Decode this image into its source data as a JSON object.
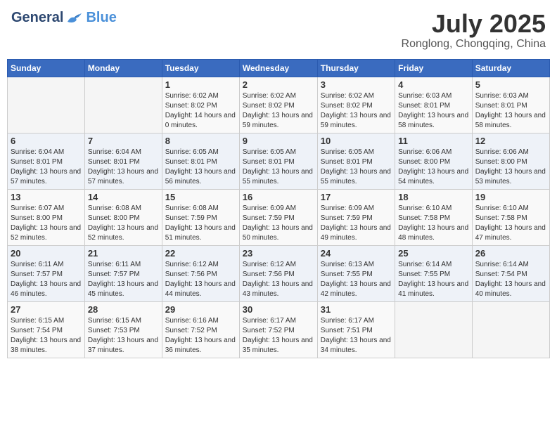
{
  "header": {
    "logo_general": "General",
    "logo_blue": "Blue",
    "month": "July 2025",
    "location": "Ronglong, Chongqing, China"
  },
  "weekdays": [
    "Sunday",
    "Monday",
    "Tuesday",
    "Wednesday",
    "Thursday",
    "Friday",
    "Saturday"
  ],
  "weeks": [
    [
      {
        "day": "",
        "sunrise": "",
        "sunset": "",
        "daylight": ""
      },
      {
        "day": "",
        "sunrise": "",
        "sunset": "",
        "daylight": ""
      },
      {
        "day": "1",
        "sunrise": "Sunrise: 6:02 AM",
        "sunset": "Sunset: 8:02 PM",
        "daylight": "Daylight: 14 hours and 0 minutes."
      },
      {
        "day": "2",
        "sunrise": "Sunrise: 6:02 AM",
        "sunset": "Sunset: 8:02 PM",
        "daylight": "Daylight: 13 hours and 59 minutes."
      },
      {
        "day": "3",
        "sunrise": "Sunrise: 6:02 AM",
        "sunset": "Sunset: 8:02 PM",
        "daylight": "Daylight: 13 hours and 59 minutes."
      },
      {
        "day": "4",
        "sunrise": "Sunrise: 6:03 AM",
        "sunset": "Sunset: 8:01 PM",
        "daylight": "Daylight: 13 hours and 58 minutes."
      },
      {
        "day": "5",
        "sunrise": "Sunrise: 6:03 AM",
        "sunset": "Sunset: 8:01 PM",
        "daylight": "Daylight: 13 hours and 58 minutes."
      }
    ],
    [
      {
        "day": "6",
        "sunrise": "Sunrise: 6:04 AM",
        "sunset": "Sunset: 8:01 PM",
        "daylight": "Daylight: 13 hours and 57 minutes."
      },
      {
        "day": "7",
        "sunrise": "Sunrise: 6:04 AM",
        "sunset": "Sunset: 8:01 PM",
        "daylight": "Daylight: 13 hours and 57 minutes."
      },
      {
        "day": "8",
        "sunrise": "Sunrise: 6:05 AM",
        "sunset": "Sunset: 8:01 PM",
        "daylight": "Daylight: 13 hours and 56 minutes."
      },
      {
        "day": "9",
        "sunrise": "Sunrise: 6:05 AM",
        "sunset": "Sunset: 8:01 PM",
        "daylight": "Daylight: 13 hours and 55 minutes."
      },
      {
        "day": "10",
        "sunrise": "Sunrise: 6:05 AM",
        "sunset": "Sunset: 8:01 PM",
        "daylight": "Daylight: 13 hours and 55 minutes."
      },
      {
        "day": "11",
        "sunrise": "Sunrise: 6:06 AM",
        "sunset": "Sunset: 8:00 PM",
        "daylight": "Daylight: 13 hours and 54 minutes."
      },
      {
        "day": "12",
        "sunrise": "Sunrise: 6:06 AM",
        "sunset": "Sunset: 8:00 PM",
        "daylight": "Daylight: 13 hours and 53 minutes."
      }
    ],
    [
      {
        "day": "13",
        "sunrise": "Sunrise: 6:07 AM",
        "sunset": "Sunset: 8:00 PM",
        "daylight": "Daylight: 13 hours and 52 minutes."
      },
      {
        "day": "14",
        "sunrise": "Sunrise: 6:08 AM",
        "sunset": "Sunset: 8:00 PM",
        "daylight": "Daylight: 13 hours and 52 minutes."
      },
      {
        "day": "15",
        "sunrise": "Sunrise: 6:08 AM",
        "sunset": "Sunset: 7:59 PM",
        "daylight": "Daylight: 13 hours and 51 minutes."
      },
      {
        "day": "16",
        "sunrise": "Sunrise: 6:09 AM",
        "sunset": "Sunset: 7:59 PM",
        "daylight": "Daylight: 13 hours and 50 minutes."
      },
      {
        "day": "17",
        "sunrise": "Sunrise: 6:09 AM",
        "sunset": "Sunset: 7:59 PM",
        "daylight": "Daylight: 13 hours and 49 minutes."
      },
      {
        "day": "18",
        "sunrise": "Sunrise: 6:10 AM",
        "sunset": "Sunset: 7:58 PM",
        "daylight": "Daylight: 13 hours and 48 minutes."
      },
      {
        "day": "19",
        "sunrise": "Sunrise: 6:10 AM",
        "sunset": "Sunset: 7:58 PM",
        "daylight": "Daylight: 13 hours and 47 minutes."
      }
    ],
    [
      {
        "day": "20",
        "sunrise": "Sunrise: 6:11 AM",
        "sunset": "Sunset: 7:57 PM",
        "daylight": "Daylight: 13 hours and 46 minutes."
      },
      {
        "day": "21",
        "sunrise": "Sunrise: 6:11 AM",
        "sunset": "Sunset: 7:57 PM",
        "daylight": "Daylight: 13 hours and 45 minutes."
      },
      {
        "day": "22",
        "sunrise": "Sunrise: 6:12 AM",
        "sunset": "Sunset: 7:56 PM",
        "daylight": "Daylight: 13 hours and 44 minutes."
      },
      {
        "day": "23",
        "sunrise": "Sunrise: 6:12 AM",
        "sunset": "Sunset: 7:56 PM",
        "daylight": "Daylight: 13 hours and 43 minutes."
      },
      {
        "day": "24",
        "sunrise": "Sunrise: 6:13 AM",
        "sunset": "Sunset: 7:55 PM",
        "daylight": "Daylight: 13 hours and 42 minutes."
      },
      {
        "day": "25",
        "sunrise": "Sunrise: 6:14 AM",
        "sunset": "Sunset: 7:55 PM",
        "daylight": "Daylight: 13 hours and 41 minutes."
      },
      {
        "day": "26",
        "sunrise": "Sunrise: 6:14 AM",
        "sunset": "Sunset: 7:54 PM",
        "daylight": "Daylight: 13 hours and 40 minutes."
      }
    ],
    [
      {
        "day": "27",
        "sunrise": "Sunrise: 6:15 AM",
        "sunset": "Sunset: 7:54 PM",
        "daylight": "Daylight: 13 hours and 38 minutes."
      },
      {
        "day": "28",
        "sunrise": "Sunrise: 6:15 AM",
        "sunset": "Sunset: 7:53 PM",
        "daylight": "Daylight: 13 hours and 37 minutes."
      },
      {
        "day": "29",
        "sunrise": "Sunrise: 6:16 AM",
        "sunset": "Sunset: 7:52 PM",
        "daylight": "Daylight: 13 hours and 36 minutes."
      },
      {
        "day": "30",
        "sunrise": "Sunrise: 6:17 AM",
        "sunset": "Sunset: 7:52 PM",
        "daylight": "Daylight: 13 hours and 35 minutes."
      },
      {
        "day": "31",
        "sunrise": "Sunrise: 6:17 AM",
        "sunset": "Sunset: 7:51 PM",
        "daylight": "Daylight: 13 hours and 34 minutes."
      },
      {
        "day": "",
        "sunrise": "",
        "sunset": "",
        "daylight": ""
      },
      {
        "day": "",
        "sunrise": "",
        "sunset": "",
        "daylight": ""
      }
    ]
  ]
}
